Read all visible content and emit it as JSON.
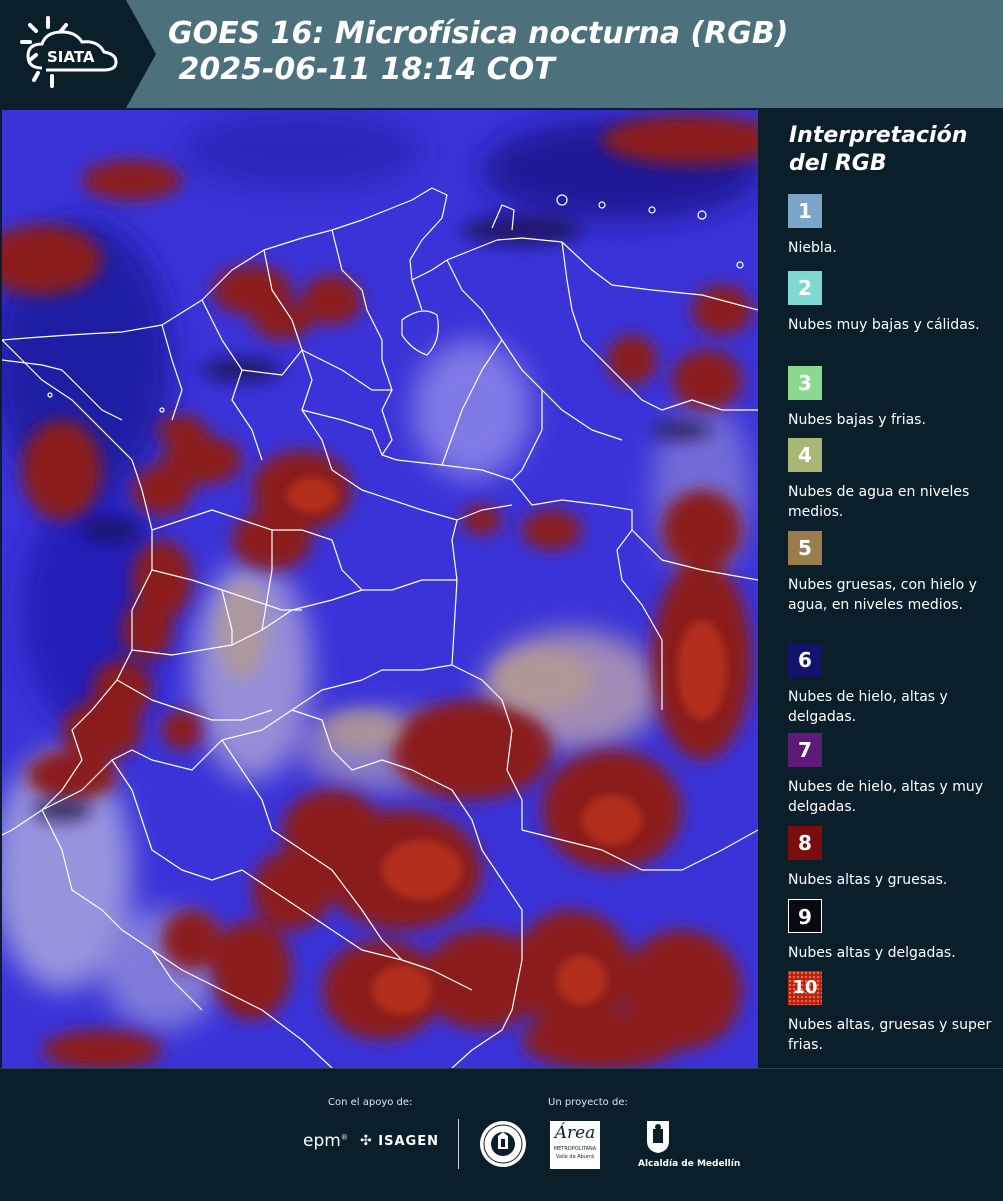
{
  "header": {
    "logo_text": "SIATA",
    "title_line1": "GOES 16: Microfísica nocturna (RGB)",
    "title_line2": " 2025-06-11 18:14 COT"
  },
  "legend": {
    "title_line1": "Interpretación",
    "title_line2": "del RGB",
    "items": [
      {
        "num": "1",
        "color": "#7ba4c9",
        "label": "Niebla."
      },
      {
        "num": "2",
        "color": "#7ed9d2",
        "label": "Nubes muy bajas y cálidas."
      },
      {
        "num": "3",
        "color": "#8bd98c",
        "label": "Nubes bajas y frias."
      },
      {
        "num": "4",
        "color": "#a8b774",
        "label": "Nubes de agua en niveles medios."
      },
      {
        "num": "5",
        "color": "#9b7d4d",
        "label": "Nubes gruesas, con hielo y agua, en niveles medios."
      },
      {
        "num": "6",
        "color": "#13136c",
        "label": "Nubes de hielo, altas y delgadas."
      },
      {
        "num": "7",
        "color": "#5e1a78",
        "label": "Nubes de hielo, altas y muy delgadas."
      },
      {
        "num": "8",
        "color": "#7a0d0d",
        "label": "Nubes altas y gruesas."
      },
      {
        "num": "9",
        "color": "#0a0a14",
        "label": "Nubes altas y delgadas."
      },
      {
        "num": "10",
        "color": "#b81e10",
        "label": "Nubes altas, gruesas y super frias."
      }
    ]
  },
  "footer": {
    "support_label": "Con el apoyo de:",
    "project_label": "Un proyecto de:",
    "sponsor_epm": "epm",
    "sponsor_isagen": "ISAGEN",
    "partner_area_line1": "Área",
    "partner_area_line2": "METROPOLITANA",
    "partner_area_line3": "Valle de Aburrá",
    "partner_medellin": "Alcaldía de Medellín"
  }
}
